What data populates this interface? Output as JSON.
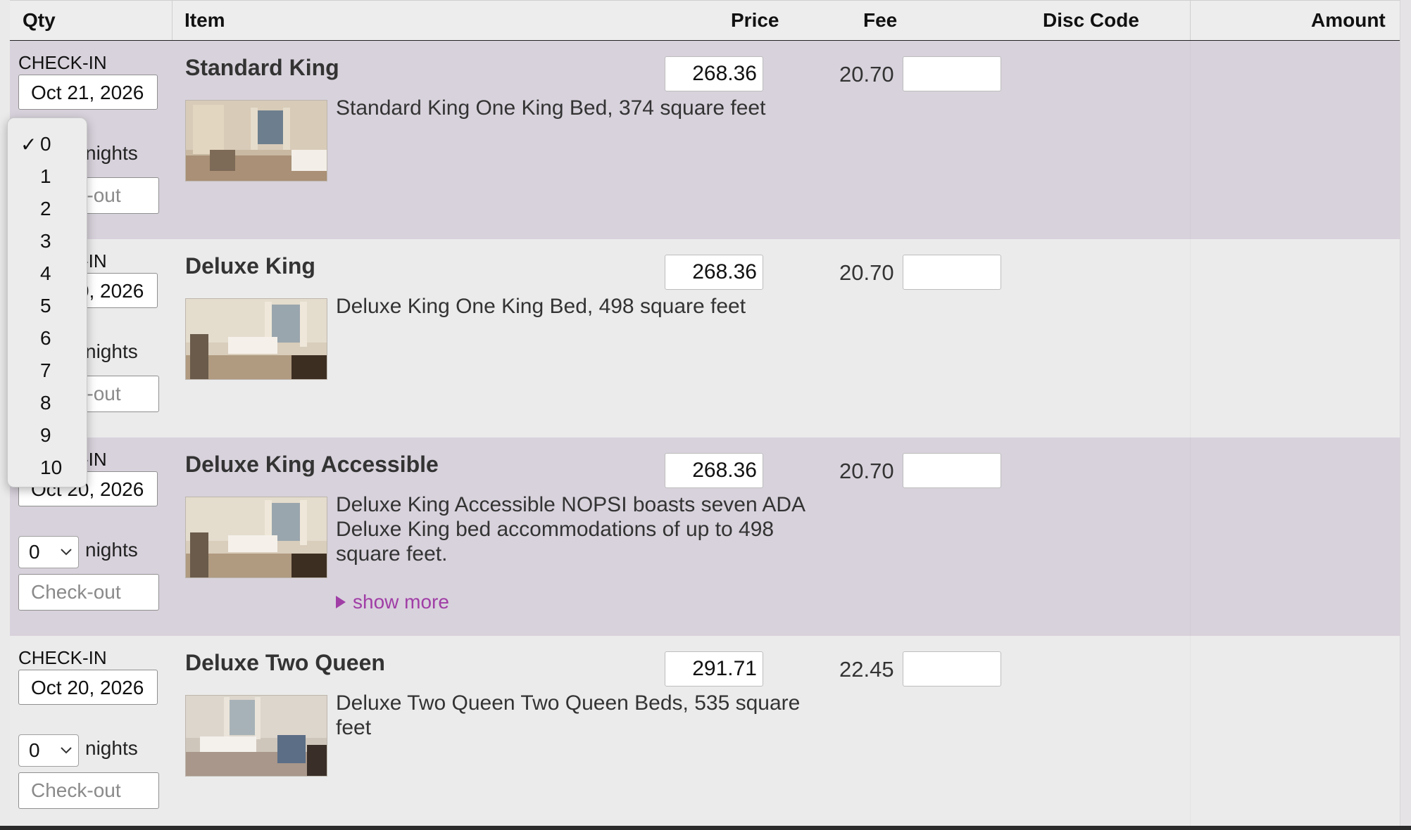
{
  "headers": {
    "qty": "Qty",
    "item": "Item",
    "price": "Price",
    "fee": "Fee",
    "disc_code": "Disc Code",
    "amount": "Amount"
  },
  "rows": [
    {
      "checkin_label": "CHECK-IN",
      "checkin_date": "Oct 21, 2026",
      "nights_value": "0",
      "nights_label": "nights",
      "checkout_placeholder": "Check-out",
      "title": "Standard King",
      "description": "Standard King One King Bed, 374 square feet",
      "price": "268.36",
      "fee": "20.70",
      "show_more": ""
    },
    {
      "checkin_label": "CHECK-IN",
      "checkin_date": "Oct 20, 2026",
      "nights_value": "0",
      "nights_label": "nights",
      "checkout_placeholder": "Check-out",
      "title": "Deluxe King",
      "description": "Deluxe King One King Bed, 498 square feet",
      "price": "268.36",
      "fee": "20.70",
      "show_more": ""
    },
    {
      "checkin_label": "CHECK-IN",
      "checkin_date": "Oct 20, 2026",
      "nights_value": "0",
      "nights_label": "nights",
      "checkout_placeholder": "Check-out",
      "title": "Deluxe King Accessible",
      "description": "Deluxe King Accessible NOPSI boasts seven ADA Deluxe King bed accommodations of up to 498 square feet.",
      "price": "268.36",
      "fee": "20.70",
      "show_more": "show more"
    },
    {
      "checkin_label": "CHECK-IN",
      "checkin_date": "Oct 20, 2026",
      "nights_value": "0",
      "nights_label": "nights",
      "checkout_placeholder": "Check-out",
      "title": "Deluxe Two Queen",
      "description": "Deluxe Two Queen Two Queen Beds, 535 square feet",
      "price": "291.71",
      "fee": "22.45",
      "show_more": ""
    }
  ],
  "nights_dropdown": {
    "selected": "0",
    "check_mark": "✓",
    "options": [
      "0",
      "1",
      "2",
      "3",
      "4",
      "5",
      "6",
      "7",
      "8",
      "9",
      "10"
    ]
  },
  "colors": {
    "row_highlight": "#d8d2dc",
    "row_plain": "#ebebeb",
    "link": "#a03ea6"
  }
}
